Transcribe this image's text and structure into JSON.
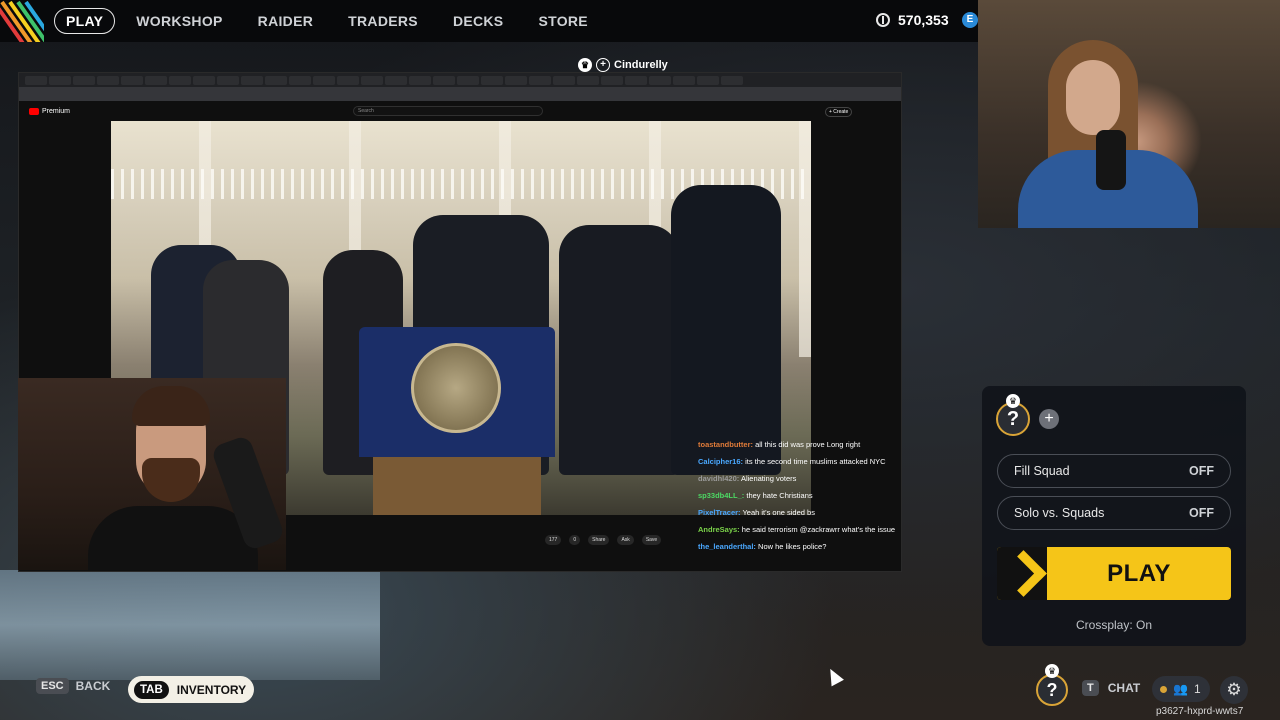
{
  "topnav": {
    "items": [
      "PLAY",
      "WORKSHOP",
      "RAIDER",
      "TRADERS",
      "DECKS",
      "STORE"
    ],
    "currency": "570,353",
    "coin_icon": "coin-icon",
    "second_currency_icon": "blue-coin-icon"
  },
  "streamer_name": "Cindurelly",
  "browser": {
    "site_label": "Premium",
    "search_placeholder": "Search",
    "create_label": "+ Create",
    "video_actions": [
      "177",
      "0",
      "Share",
      "Ask",
      "Save"
    ]
  },
  "chat": [
    {
      "user": "toastandbutter:",
      "msg": "all this did was prove Long right",
      "color": "#e07b39"
    },
    {
      "user": "Calcipher16:",
      "msg": "its the second time muslims attacked NYC",
      "color": "#4aa8ff"
    },
    {
      "user": "davidhl420:",
      "msg": "Alienating voters",
      "color": "#9a9a9a"
    },
    {
      "user": "sp33db4LL_:",
      "msg": "they hate Christians",
      "color": "#4cd964"
    },
    {
      "user": "PixelTracer:",
      "msg": "Yeah it's one sided bs",
      "color": "#4aa8ff"
    },
    {
      "user": "AndreSays:",
      "msg": "he said terrorism @zackrawrr what's the issue",
      "color": "#7bd34a"
    },
    {
      "user": "the_leanderthal:",
      "msg": "Now he likes police?",
      "color": "#4aa8ff"
    }
  ],
  "panel": {
    "slot_label": "?",
    "add_label": "+",
    "fill_squad": {
      "label": "Fill Squad",
      "state": "OFF"
    },
    "solo_vs_squads": {
      "label": "Solo vs. Squads",
      "state": "OFF"
    },
    "play_label": "PLAY",
    "crossplay": "Crossplay: On"
  },
  "bottom": {
    "esc_key": "ESC",
    "back_label": "BACK",
    "tab_key": "TAB",
    "inventory_label": "INVENTORY",
    "slot_label": "?",
    "t_key": "T",
    "chat_label": "CHAT",
    "friends_count": "1",
    "session_id": "p3627-hxprd-wwts7"
  },
  "colors": {
    "accent_yellow": "#f5c518",
    "slot_ring": "#d9a437",
    "panel_bg": "#10131a"
  }
}
